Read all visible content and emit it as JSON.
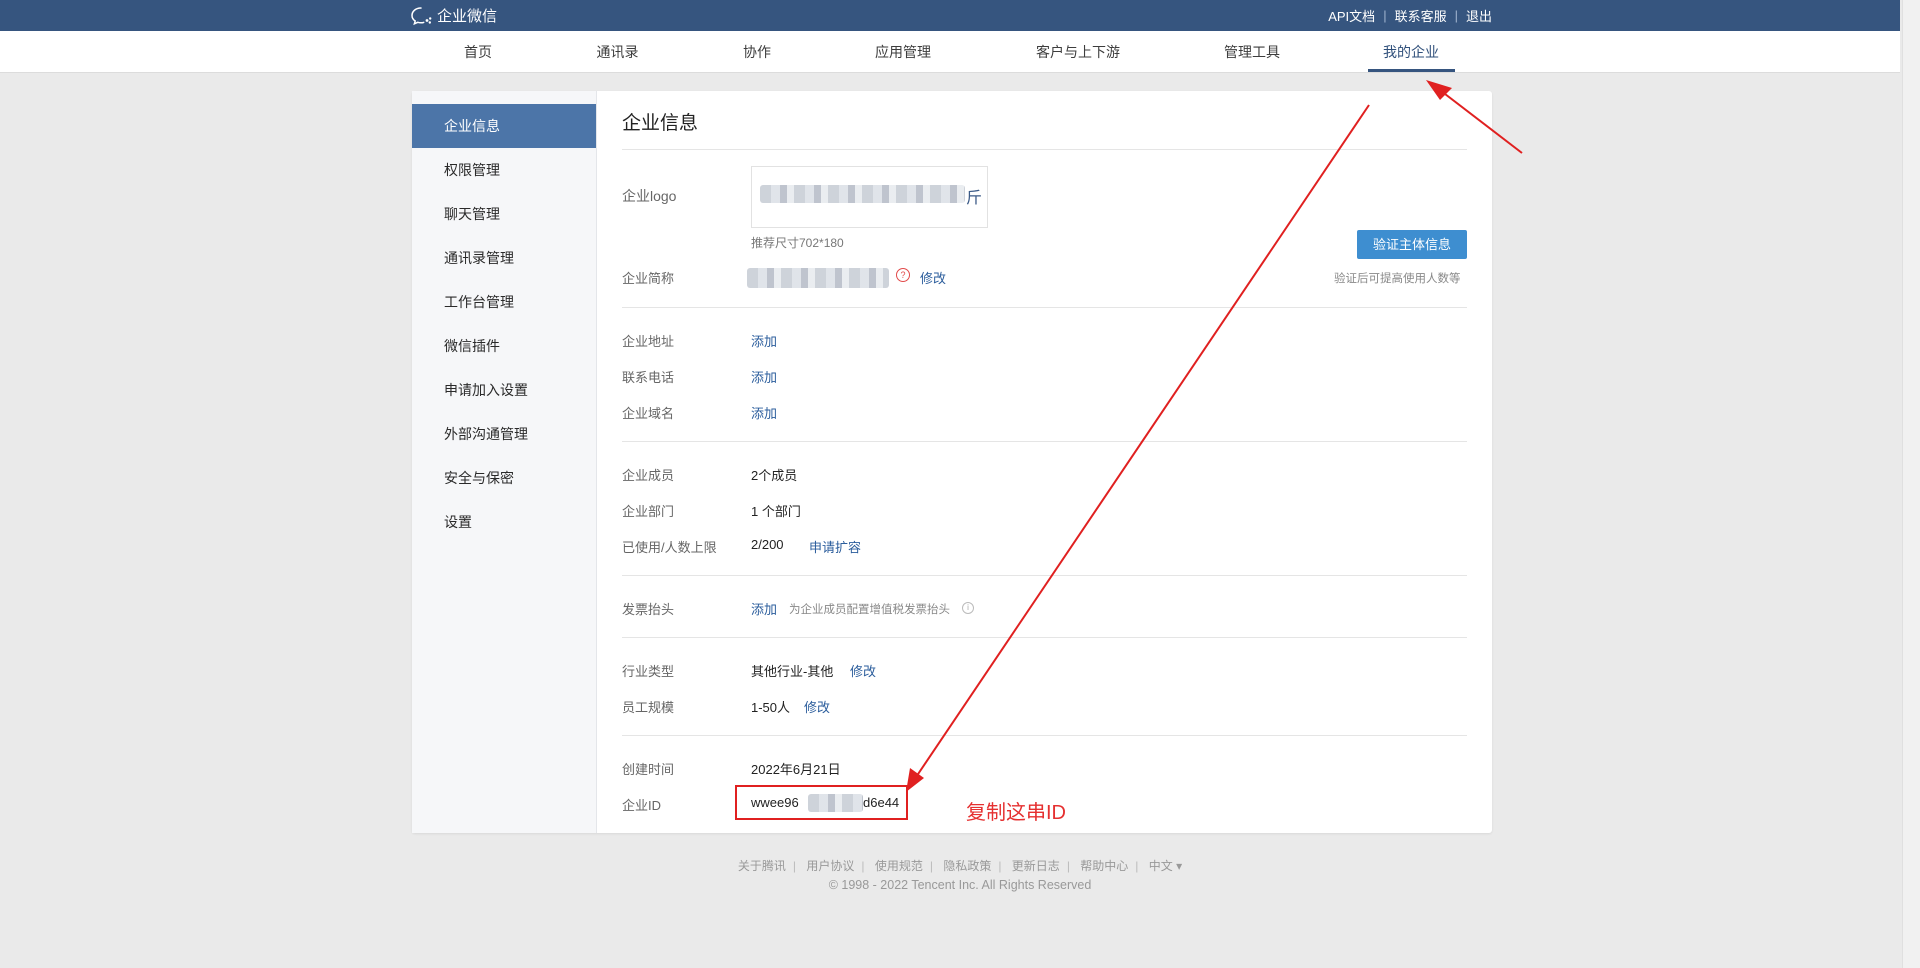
{
  "header": {
    "brand": "企业微信",
    "links": [
      "API文档",
      "联系客服",
      "退出"
    ]
  },
  "nav": {
    "items": [
      "首页",
      "通讯录",
      "协作",
      "应用管理",
      "客户与上下游",
      "管理工具",
      "我的企业"
    ],
    "active": "我的企业"
  },
  "sidebar": {
    "items": [
      "企业信息",
      "权限管理",
      "聊天管理",
      "通讯录管理",
      "工作台管理",
      "微信插件",
      "申请加入设置",
      "外部沟通管理",
      "安全与保密",
      "设置"
    ],
    "active": "企业信息"
  },
  "content": {
    "title": "企业信息",
    "logo": {
      "label": "企业logo",
      "hint": "推荐尺寸702*180",
      "tail_char": "斤"
    },
    "short_name": {
      "label": "企业简称",
      "help": "?",
      "action": "修改"
    },
    "verify": {
      "button": "验证主体信息",
      "hint": "验证后可提高使用人数等"
    },
    "address": {
      "label": "企业地址",
      "action": "添加"
    },
    "phone": {
      "label": "联系电话",
      "action": "添加"
    },
    "domain": {
      "label": "企业域名",
      "action": "添加"
    },
    "members": {
      "label": "企业成员",
      "value": "2个成员"
    },
    "departments": {
      "label": "企业部门",
      "value": "1 个部门"
    },
    "usage": {
      "label": "已使用/人数上限",
      "value": "2/200",
      "action": "申请扩容"
    },
    "invoice": {
      "label": "发票抬头",
      "action": "添加",
      "hint": "为企业成员配置增值税发票抬头",
      "info": "i"
    },
    "industry": {
      "label": "行业类型",
      "value": "其他行业-其他",
      "action": "修改"
    },
    "scale": {
      "label": "员工规模",
      "value": "1-50人",
      "action": "修改"
    },
    "created": {
      "label": "创建时间",
      "value": "2022年6月21日"
    },
    "corp_id": {
      "label": "企业ID",
      "value_prefix": "wwee96",
      "value_suffix": "d6e44"
    }
  },
  "annotation": {
    "text": "复制这串ID",
    "color": "#e53030"
  },
  "footer": {
    "links": [
      "关于腾讯",
      "用户协议",
      "使用规范",
      "隐私政策",
      "更新日志",
      "帮助中心",
      "中文 ▾"
    ],
    "copyright": "© 1998 - 2022 Tencent Inc. All Rights Reserved"
  }
}
